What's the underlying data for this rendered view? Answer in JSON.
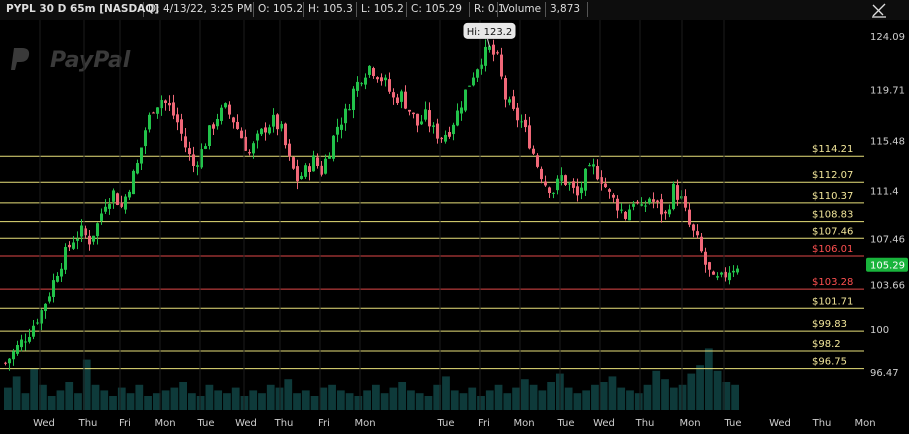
{
  "header": {
    "symbol": "PYPL 30 D 65m [NASDAQ]",
    "date": "D: 4/13/22, 3:25 PM",
    "open": "O: 105.2",
    "high": "H: 105.3",
    "low": "L: 105.2",
    "close": "C: 105.29",
    "range": "R: 0.1",
    "volume_label": "Volume",
    "volume_value": "3,873"
  },
  "watermark": "PayPal",
  "colors": {
    "up": "#22c24a",
    "down": "#f06878",
    "yellow_line": "#e8e07a",
    "red_line": "#e04848",
    "volume": "#0e3a3a",
    "current_price_bg": "#19b43c"
  },
  "chart_data": {
    "type": "candlestick",
    "y_range": [
      96.0,
      126.0
    ],
    "y_ticks": [
      "124.09",
      "119.71",
      "115.48",
      "111.4",
      "107.46",
      "103.66",
      "100",
      "96.47"
    ],
    "x_labels": [
      "Wed",
      "Thu",
      "Fri",
      "Mon",
      "Tue",
      "Wed",
      "Thu",
      "Fri",
      "Mon",
      "Tue",
      "Fri",
      "Mon",
      "Tue",
      "Wed",
      "Thu",
      "Mon",
      "Tue",
      "Wed",
      "Thu",
      "Mon",
      "Tue"
    ],
    "levels": [
      {
        "price": 114.21,
        "label": "$114.21",
        "color": "yellow"
      },
      {
        "price": 112.07,
        "label": "$112.07",
        "color": "yellow"
      },
      {
        "price": 110.37,
        "label": "$110.37",
        "color": "yellow"
      },
      {
        "price": 108.83,
        "label": "$108.83",
        "color": "yellow"
      },
      {
        "price": 107.46,
        "label": "$107.46",
        "color": "yellow"
      },
      {
        "price": 106.01,
        "label": "$106.01",
        "color": "red"
      },
      {
        "price": 103.28,
        "label": "$103.28",
        "color": "red"
      },
      {
        "price": 101.71,
        "label": "$101.71",
        "color": "yellow"
      },
      {
        "price": 99.83,
        "label": "$99.83",
        "color": "yellow"
      },
      {
        "price": 98.2,
        "label": "$98.2",
        "color": "yellow"
      },
      {
        "price": 96.75,
        "label": "$96.75",
        "color": "yellow"
      }
    ],
    "high_annotation": "Hi: 123.2",
    "high_value": 123.2,
    "current_price": 105.29,
    "current_price_label": "105.29",
    "close_path": [
      [
        0,
        97.2
      ],
      [
        3,
        98.5
      ],
      [
        6,
        99.8
      ],
      [
        9,
        101.5
      ],
      [
        11,
        103.0
      ],
      [
        13,
        104.8
      ],
      [
        15,
        106.2
      ],
      [
        17,
        107.4
      ],
      [
        19,
        108.0
      ],
      [
        21,
        107.3
      ],
      [
        23,
        108.6
      ],
      [
        25,
        110.5
      ],
      [
        27,
        111.2
      ],
      [
        29,
        110.0
      ],
      [
        31,
        111.8
      ],
      [
        33,
        113.5
      ],
      [
        35,
        116.4
      ],
      [
        37,
        118.3
      ],
      [
        39,
        118.9
      ],
      [
        41,
        118.2
      ],
      [
        43,
        117.0
      ],
      [
        45,
        115.0
      ],
      [
        47,
        113.4
      ],
      [
        49,
        114.6
      ],
      [
        51,
        116.2
      ],
      [
        53,
        117.5
      ],
      [
        55,
        118.1
      ],
      [
        57,
        117.2
      ],
      [
        59,
        115.8
      ],
      [
        61,
        114.4
      ],
      [
        63,
        115.6
      ],
      [
        65,
        116.6
      ],
      [
        67,
        117.1
      ],
      [
        69,
        116.3
      ],
      [
        71,
        113.8
      ],
      [
        73,
        112.3
      ],
      [
        75,
        113.0
      ],
      [
        77,
        113.9
      ],
      [
        79,
        113.0
      ],
      [
        81,
        114.8
      ],
      [
        83,
        116.7
      ],
      [
        85,
        117.7
      ],
      [
        87,
        119.6
      ],
      [
        89,
        120.8
      ],
      [
        91,
        121.6
      ],
      [
        93,
        121.0
      ],
      [
        95,
        120.2
      ],
      [
        97,
        118.9
      ],
      [
        99,
        119.2
      ],
      [
        101,
        118.0
      ],
      [
        103,
        116.8
      ],
      [
        105,
        117.5
      ],
      [
        107,
        116.3
      ],
      [
        109,
        115.8
      ],
      [
        111,
        116.4
      ],
      [
        113,
        117.8
      ],
      [
        115,
        119.5
      ],
      [
        117,
        121.0
      ],
      [
        119,
        122.3
      ],
      [
        121,
        123.0
      ],
      [
        123,
        122.1
      ],
      [
        125,
        119.0
      ],
      [
        127,
        117.7
      ],
      [
        129,
        117.0
      ],
      [
        131,
        115.4
      ],
      [
        133,
        113.5
      ],
      [
        135,
        112.0
      ],
      [
        137,
        111.4
      ],
      [
        139,
        112.5
      ],
      [
        141,
        111.8
      ],
      [
        143,
        110.9
      ],
      [
        145,
        112.6
      ],
      [
        147,
        113.2
      ],
      [
        149,
        112.4
      ],
      [
        151,
        111.0
      ],
      [
        153,
        110.2
      ],
      [
        155,
        109.3
      ],
      [
        157,
        110.6
      ],
      [
        159,
        109.7
      ],
      [
        161,
        110.8
      ],
      [
        163,
        110.1
      ],
      [
        165,
        109.3
      ],
      [
        167,
        111.5
      ],
      [
        169,
        110.6
      ],
      [
        171,
        108.5
      ],
      [
        173,
        107.2
      ],
      [
        175,
        105.3
      ],
      [
        177,
        103.9
      ],
      [
        179,
        104.1
      ],
      [
        181,
        104.9
      ],
      [
        183,
        105.29
      ]
    ],
    "volume_bars": [
      8,
      12,
      6,
      15,
      9,
      5,
      7,
      10,
      6,
      18,
      9,
      7,
      5,
      8,
      6,
      9,
      5,
      6,
      7,
      8,
      10,
      6,
      5,
      9,
      7,
      6,
      8,
      5,
      7,
      6,
      9,
      8,
      11,
      6,
      7,
      5,
      8,
      9,
      7,
      6,
      5,
      7,
      9,
      6,
      8,
      10,
      7,
      6,
      5,
      9,
      12,
      7,
      6,
      8,
      5,
      7,
      9,
      6,
      8,
      11,
      9,
      7,
      10,
      13,
      8,
      6,
      7,
      9,
      10,
      12,
      8,
      7,
      6,
      9,
      14,
      11,
      8,
      9,
      13,
      16,
      22,
      14,
      10,
      9
    ]
  }
}
